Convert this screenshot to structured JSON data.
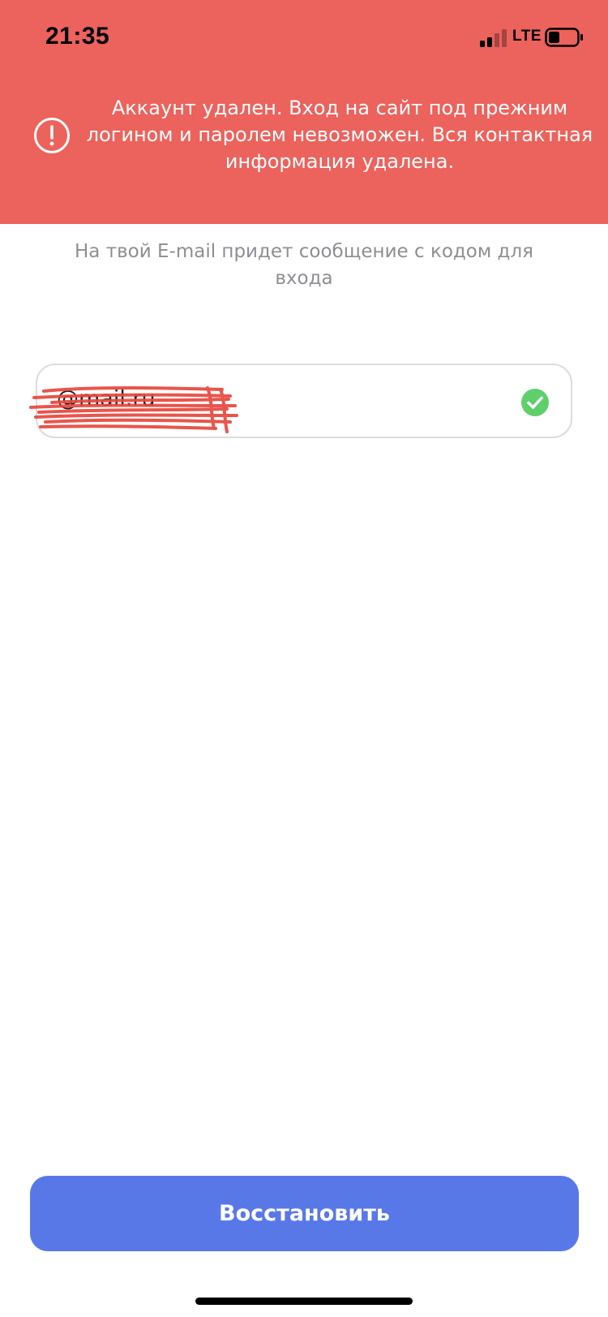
{
  "status_bar": {
    "time": "21:35",
    "network": "LTE",
    "icons": {
      "signal": "cellular-signal-icon",
      "battery": "battery-low-icon"
    }
  },
  "alert": {
    "icon": "alert-circle-icon",
    "message": "Аккаунт удален. Вход на сайт под прежним логином и паролем невозможен. Вся контактная информация удалена."
  },
  "hint": "На твой E-mail придет сообщение с кодом для входа",
  "email_field": {
    "visible_value": "@mail.ru",
    "status_icon": "valid-check-icon"
  },
  "restore_button": {
    "label": "Восстановить"
  },
  "colors": {
    "banner": "#ec625c",
    "button": "#5978e8",
    "valid": "#5ecf6b",
    "hint_text": "#8e8e93"
  }
}
